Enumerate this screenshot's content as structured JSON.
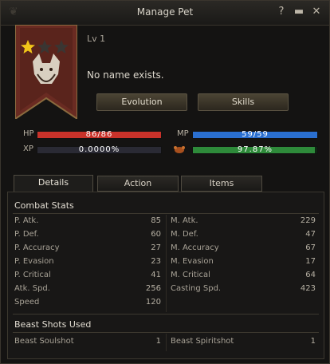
{
  "window": {
    "title": "Manage Pet"
  },
  "pet": {
    "level": "Lv 1",
    "name_text": "No name exists."
  },
  "buttons": {
    "evolution": "Evolution",
    "skills": "Skills"
  },
  "bars": {
    "hp_label": "HP",
    "hp_text": "86/86",
    "hp_fill": 1.0,
    "mp_label": "MP",
    "mp_text": "59/59",
    "mp_fill": 1.0,
    "xp_label": "XP",
    "xp_text": "0.0000%",
    "xp_fill": 0.0,
    "food_text": "97.87%",
    "food_fill": 0.9787
  },
  "tabs": [
    "Details",
    "Action",
    "Items"
  ],
  "combat": {
    "heading": "Combat Stats",
    "left": [
      {
        "name": "P. Atk.",
        "value": "85"
      },
      {
        "name": "P. Def.",
        "value": "60"
      },
      {
        "name": "P. Accuracy",
        "value": "27"
      },
      {
        "name": "P. Evasion",
        "value": "23"
      },
      {
        "name": "P. Critical",
        "value": "41"
      },
      {
        "name": "Atk. Spd.",
        "value": "256"
      },
      {
        "name": "Speed",
        "value": "120"
      }
    ],
    "right": [
      {
        "name": "M. Atk.",
        "value": "229"
      },
      {
        "name": "M. Def.",
        "value": "47"
      },
      {
        "name": "M. Accuracy",
        "value": "67"
      },
      {
        "name": "M. Evasion",
        "value": "17"
      },
      {
        "name": "M. Critical",
        "value": "64"
      },
      {
        "name": "Casting Spd.",
        "value": "423"
      }
    ]
  },
  "shots": {
    "heading": "Beast Shots Used",
    "soulshot": {
      "name": "Beast Soulshot",
      "value": "1"
    },
    "spiritshot": {
      "name": "Beast Spiritshot",
      "value": "1"
    }
  },
  "colors": {
    "hp": "#c8322a",
    "mp": "#2a6fd0",
    "xp": "#3a3a46",
    "food": "#2e8a3a"
  }
}
